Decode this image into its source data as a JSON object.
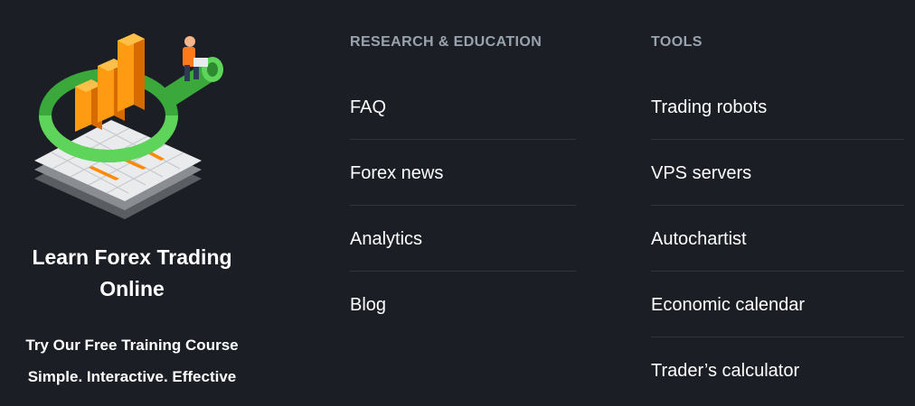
{
  "promo": {
    "title": "Learn Forex Trading Online",
    "subtitle_1": "Try Our Free Training Course",
    "subtitle_2": "Simple. Interactive. Effective",
    "illustration": "magnifier-chart-illustration"
  },
  "columns": {
    "research": {
      "heading": "RESEARCH & EDUCATION",
      "items": [
        {
          "label": "FAQ"
        },
        {
          "label": "Forex news"
        },
        {
          "label": "Analytics"
        },
        {
          "label": "Blog"
        }
      ]
    },
    "tools": {
      "heading": "TOOLS",
      "items": [
        {
          "label": "Trading robots"
        },
        {
          "label": "VPS servers"
        },
        {
          "label": "Autochartist"
        },
        {
          "label": "Economic calendar"
        },
        {
          "label": "Trader’s calculator"
        }
      ]
    }
  },
  "colors": {
    "background": "#1b1f25",
    "heading": "#9aa3ad",
    "divider": "#2f353d",
    "accent_green": "#4cc94a",
    "accent_orange": "#ff8a00"
  }
}
